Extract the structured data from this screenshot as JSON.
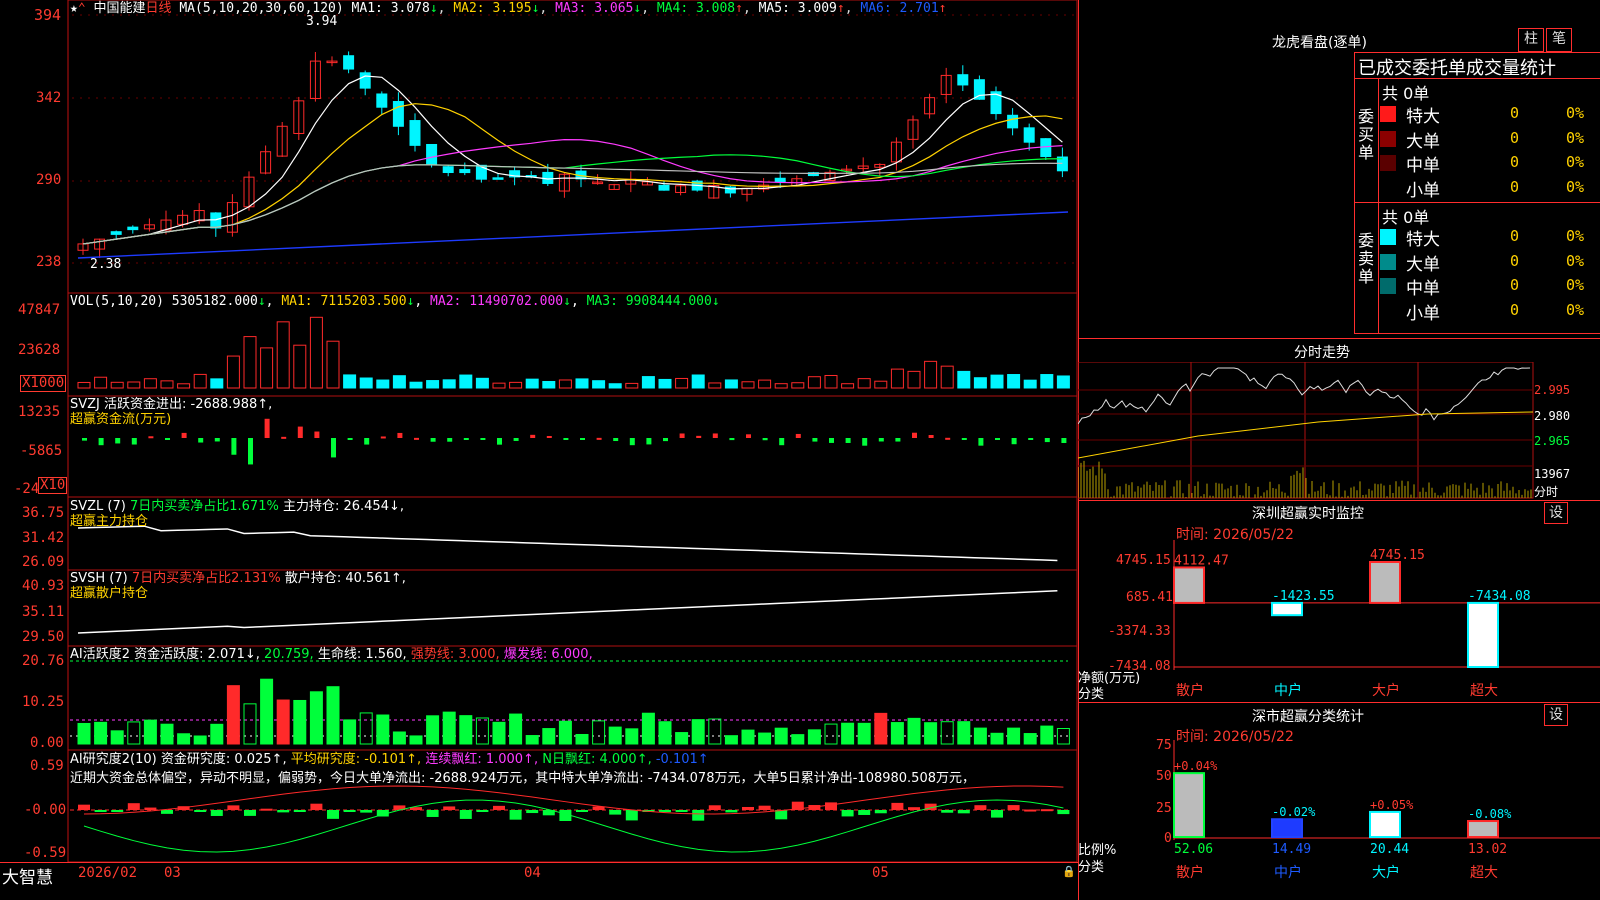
{
  "header": {
    "top_ylabel": "394",
    "stock_name": "中国能建",
    "period": "日线",
    "ma_params": "MA(5,10,20,30,60,120)",
    "ma_values": [
      {
        "label": "MA1:",
        "value": "3.078",
        "arrow": "↓"
      },
      {
        "label": "MA2:",
        "value": "3.195",
        "arrow": "↓"
      },
      {
        "label": "MA3:",
        "value": "3.065",
        "arrow": "↓"
      },
      {
        "label": "MA4:",
        "value": "3.008",
        "arrow": "↑"
      },
      {
        "label": "MA5:",
        "value": "3.009",
        "arrow": "↑"
      },
      {
        "label": "MA6:",
        "value": "2.701",
        "arrow": "↑"
      }
    ],
    "high_mark": "3.94",
    "low_mark": "2.38"
  },
  "price_axis": [
    "394",
    "342",
    "290",
    "238"
  ],
  "vol_panel": {
    "title": "VOL(5,10,20)",
    "value": "5305182.000",
    "ma1": "7115203.500",
    "ma2": "11490702.000",
    "ma3": "9908444.000",
    "axis": [
      "47847",
      "23628",
      "X1000"
    ]
  },
  "svzj_panel": {
    "line1": "SVZJ  活跃资金进出: -2688.988↑,",
    "line2": "超赢资金流(万元)",
    "axis": [
      "13235",
      "-5865",
      "-24",
      "X10"
    ]
  },
  "svzl_panel": {
    "line1a": "SVZL (7)",
    "line1b": "7日内买卖净占比1.671%",
    "line1c": "主力持仓: 26.454↓,",
    "line2": "超赢主力持仓",
    "axis": [
      "36.75",
      "31.42",
      "26.09"
    ]
  },
  "svsh_panel": {
    "line1a": "SVSH (7)",
    "line1b": "7日内买卖净占比2.131%",
    "line1c": "散户持仓: 40.561↑,",
    "line2": "超赢散户持仓",
    "axis": [
      "40.93",
      "35.11",
      "29.50"
    ]
  },
  "ai_active_panel": {
    "title": "AI活跃度2",
    "label": "资金活跃度: 2.071↓,",
    "v2": "20.759,",
    "life": "生命线: 1.560,",
    "strong": "强势线: 3.000,",
    "burst": "爆发线: 6.000,",
    "axis": [
      "20.76",
      "10.25",
      "0.00"
    ]
  },
  "ai_research_panel": {
    "title": "AI研究度2(10)",
    "label": "资金研究度: 0.025↑,",
    "avg": "平均研究度: -0.101↑,",
    "streak": "连续飘红: 1.000↑,",
    "nday": "N日飘红: 4.000↑,",
    "last": "-0.101↑",
    "summary": "近期大资金总体偏空，异动不明显，偏弱势，今日大单净流出: -2688.924万元，其中特大单净流出: -7434.078万元，大单5日累计净出-108980.508万元，",
    "axis": [
      "0.59",
      "-0.00",
      "-0.59"
    ]
  },
  "bottom_bar": {
    "brand": "大智慧",
    "dates": [
      "2026/02",
      "03",
      "04",
      "05"
    ]
  },
  "right": {
    "dragon_title": "龙虎看盘(逐单)",
    "btn_zhu": "柱",
    "btn_bi": "笔",
    "stats_title": "已成交委托单成交量统计",
    "buy_total": "共 0单",
    "buy_side": "委买单",
    "sell_total": "共 0单",
    "sell_side": "委卖单",
    "buy_rows": [
      {
        "label": "特大",
        "count": "0",
        "pct": "0%",
        "color": "#ff1a1a"
      },
      {
        "label": "大单",
        "count": "0",
        "pct": "0%",
        "color": "#8b0000"
      },
      {
        "label": "中单",
        "count": "0",
        "pct": "0%",
        "color": "#5a0000"
      },
      {
        "label": "小单",
        "count": "0",
        "pct": "0%",
        "color": ""
      }
    ],
    "sell_rows": [
      {
        "label": "特大",
        "count": "0",
        "pct": "0%",
        "color": "#00f5ff"
      },
      {
        "label": "大单",
        "count": "0",
        "pct": "0%",
        "color": "#008b8b"
      },
      {
        "label": "中单",
        "count": "0",
        "pct": "0%",
        "color": "#006b6b"
      },
      {
        "label": "小单",
        "count": "0",
        "pct": "0%",
        "color": ""
      }
    ],
    "intraday_title": "分时走势",
    "intraday_axis": [
      "2.995",
      "2.980",
      "2.965",
      "13967",
      "分时"
    ],
    "sz_monitor": {
      "title": "深圳超赢实时监控",
      "btn": "设",
      "time": "时间: 2026/05/22",
      "axis": [
        "4745.15",
        "685.41",
        "-3374.33",
        "-7434.08"
      ],
      "ylabel1": "净额(万元)",
      "ylabel2": "分类",
      "categories": [
        "散户",
        "中户",
        "大户",
        "超大"
      ],
      "values": [
        4112.47,
        -1423.55,
        4745.15,
        -7434.08
      ],
      "labels": [
        "4112.47",
        "-1423.55",
        "4745.15",
        "-7434.08"
      ]
    },
    "sz_class": {
      "title": "深市超赢分类统计",
      "btn": "设",
      "time": "时间: 2026/05/22",
      "axis": [
        "75",
        "50",
        "25",
        "0"
      ],
      "ylabel1": "比例%",
      "ylabel2": "分类",
      "categories": [
        "散户",
        "中户",
        "大户",
        "超大"
      ],
      "values": [
        52.06,
        14.49,
        20.44,
        13.02
      ],
      "changes": [
        "+0.04%",
        "-0.02%",
        "+0.05%",
        "-0.08%"
      ]
    }
  },
  "colors": {
    "red": "#ff3b30",
    "yellow": "#ffd200",
    "magenta": "#ff3bff",
    "green": "#00ff3b",
    "cyan": "#00f5ff",
    "blue": "#1e5bff"
  }
}
